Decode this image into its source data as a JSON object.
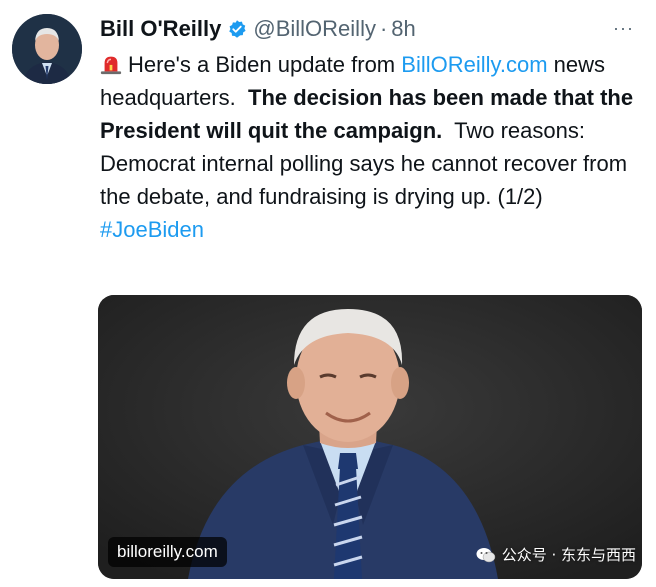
{
  "author": {
    "name": "Bill O'Reilly",
    "handle": "@BillOReilly",
    "separator": "·",
    "time": "8h",
    "verified_icon": "verified-badge-icon",
    "verified_color": "#1d9bf0"
  },
  "more_button": {
    "label": "···"
  },
  "tweet": {
    "emoji": "police-siren-icon",
    "text_intro": "Here's a Biden update from",
    "link": "BillOReilly.com",
    "text_after_link": "news headquarters.",
    "bold_text": "The decision has been made that the President will quit the campaign.",
    "text_rest": "Two reasons: Democrat internal polling says he cannot recover from the debate, and fundraising is drying up. (1/2)",
    "hashtag": "#JoeBiden"
  },
  "media": {
    "url_overlay": "billoreilly.com"
  },
  "watermark": {
    "text": "公众号 · 东东与西西"
  },
  "colors": {
    "link": "#1d9bf0",
    "text": "#0f1419",
    "secondary": "#536471"
  }
}
